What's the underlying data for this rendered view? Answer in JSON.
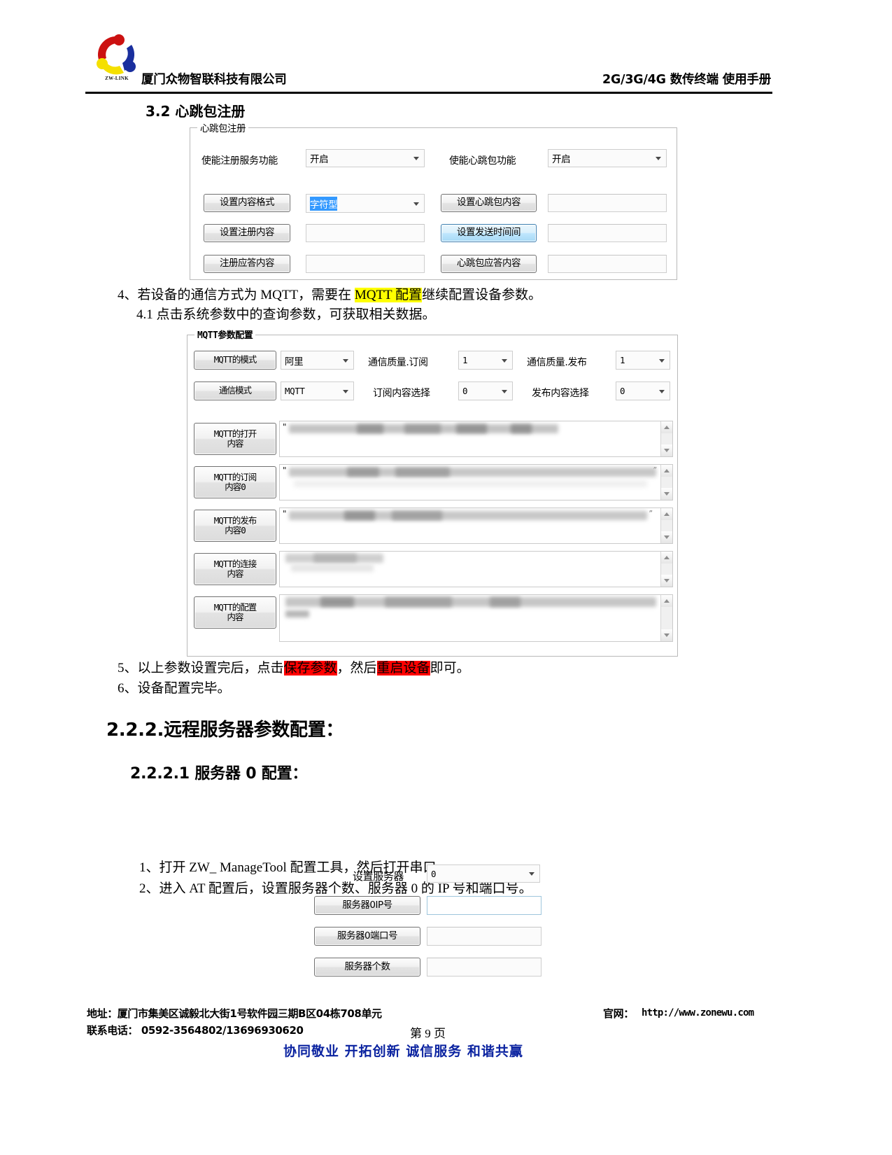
{
  "header": {
    "company": "厦门众物智联科技有限公司",
    "manual_title": "2G/3G/4G 数传终端 使用手册",
    "logo_caption": "ZW-LINK"
  },
  "section_32": {
    "heading": "3.2 心跳包注册",
    "panel_legend": "心跳包注册",
    "fields": {
      "enable_reg_label": "使能注册服务功能",
      "enable_reg_value": "开启",
      "enable_hb_label": "使能心跳包功能",
      "enable_hb_value": "开启",
      "content_format_btn": "设置内容格式",
      "content_format_value": "字符型",
      "hb_content_btn": "设置心跳包内容",
      "hb_content_value": "",
      "reg_content_btn": "设置注册内容",
      "reg_content_value": "",
      "send_interval_btn": "设置发送时间间",
      "send_interval_value": "",
      "reg_reply_btn": "注册应答内容",
      "reg_reply_value": "",
      "hb_reply_btn": "心跳包应答内容",
      "hb_reply_value": ""
    }
  },
  "step4": {
    "line1_a": "4、若设备的通信方式为 MQTT，需要在 ",
    "line1_hl": "MQTT 配置",
    "line1_b": "继续配置设备参数。",
    "line2": "4.1 点击系统参数中的查询参数，可获取相关数据。"
  },
  "mqtt_panel": {
    "legend": "MQTT参数配置",
    "mode_btn": "MQTT的模式",
    "mode_value": "阿里",
    "qos_sub_label": "通信质量.订阅",
    "qos_sub_value": "1",
    "qos_pub_label": "通信质量.发布",
    "qos_pub_value": "1",
    "comm_mode_btn": "通信模式",
    "comm_mode_value": "MQTT",
    "sub_select_label": "订阅内容选择",
    "sub_select_value": "0",
    "pub_select_label": "发布内容选择",
    "pub_select_value": "0",
    "textareas": [
      {
        "btn": "MQTT的打开\n内容",
        "btn_l1": "MQTT的打开",
        "btn_l2": "内容",
        "value": "\""
      },
      {
        "btn": "MQTT的订阅\n内容0",
        "btn_l1": "MQTT的订阅",
        "btn_l2": "内容0",
        "value": "\""
      },
      {
        "btn": "MQTT的发布\n内容0",
        "btn_l1": "MQTT的发布",
        "btn_l2": "内容0",
        "value": "\""
      },
      {
        "btn": "MQTT的连接\n内容",
        "btn_l1": "MQTT的连接",
        "btn_l2": "内容",
        "value": ""
      },
      {
        "btn": "MQTT的配置\n内容",
        "btn_l1": "MQTT的配置",
        "btn_l2": "内容",
        "value": ""
      }
    ]
  },
  "step56": {
    "line5_a": "5、以上参数设置完后，点击",
    "line5_hl1": "保存参数",
    "line5_mid": "，然后",
    "line5_hl2": "重启设备",
    "line5_b": "即可。",
    "line6": "6、设备配置完毕。"
  },
  "section_222": {
    "heading": "2.2.2.远程服务器参数配置："
  },
  "section_2221": {
    "heading": "2.2.2.1 服务器 0 配置：",
    "item1": "1、打开 ZW_ ManageTool 配置工具，然后打开串口。",
    "item2": "2、进入 AT 配置后，设置服务器个数、服务器 0 的 IP 号和端口号。",
    "form": {
      "set_server_label": "设置服务器",
      "set_server_value": "0",
      "server0_ip_btn": "服务器0IP号",
      "server0_ip_value": "",
      "server0_port_btn": "服务器0端口号",
      "server0_port_value": "",
      "server_count_btn": "服务器个数",
      "server_count_value": ""
    }
  },
  "footer": {
    "address": "地址：厦门市集美区诚毅北大街1号软件园三期B区04栋708单元",
    "phone": "联系电话： 0592-3564802/13696930620",
    "website_label": "官网：",
    "website_url": "http://www.zonewu.com",
    "page_number": "第 9 页",
    "slogan": "协同敬业  开拓创新  诚信服务  和谐共赢"
  },
  "colors": {
    "highlight_yellow": "#ffff00",
    "highlight_red": "#ff0000",
    "slogan_blue": "#0b23a0",
    "logo_red": "#cc1111",
    "logo_blue": "#1a2f9e",
    "logo_yellow": "#f5e000",
    "select_blue": "#3399ff"
  }
}
